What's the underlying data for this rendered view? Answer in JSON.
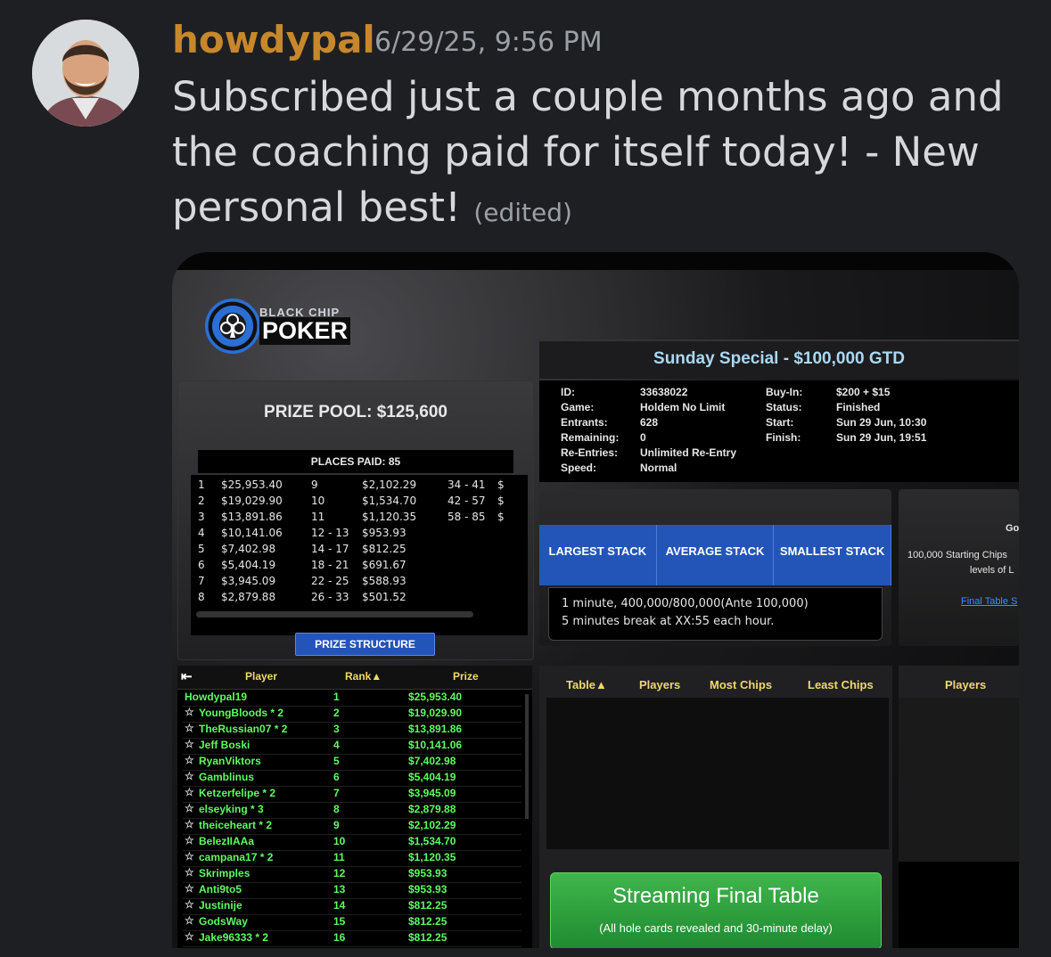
{
  "post": {
    "username": "howdypal",
    "timestamp": "6/29/25, 9:56 PM",
    "text": "Subscribed just a couple months ago and the coaching paid for itself today! - New personal best!",
    "edited": "(edited)"
  },
  "poker": {
    "logo_top": "BLACK CHIP",
    "logo_bottom": "POKER",
    "tournament_title": "Sunday Special - $100,000 GTD",
    "prize_pool": "PRIZE POOL: $125,600",
    "places_paid": "PLACES PAID: 85",
    "prize_button": "PRIZE STRUCTURE",
    "prize_rows": [
      [
        "1",
        "$25,953.40",
        "9",
        "$2,102.29",
        "34 - 41",
        "$"
      ],
      [
        "2",
        "$19,029.90",
        "10",
        "$1,534.70",
        "42 - 57",
        "$"
      ],
      [
        "3",
        "$13,891.86",
        "11",
        "$1,120.35",
        "58 - 85",
        "$"
      ],
      [
        "4",
        "$10,141.06",
        "12 - 13",
        "$953.93",
        "",
        ""
      ],
      [
        "5",
        "$7,402.98",
        "14 - 17",
        "$812.25",
        "",
        ""
      ],
      [
        "6",
        "$5,404.19",
        "18 - 21",
        "$691.67",
        "",
        ""
      ],
      [
        "7",
        "$3,945.09",
        "22 - 25",
        "$588.93",
        "",
        ""
      ],
      [
        "8",
        "$2,879.88",
        "26 - 33",
        "$501.52",
        "",
        ""
      ]
    ],
    "info_left": [
      [
        "ID:",
        "33638022"
      ],
      [
        "Game:",
        "Holdem No Limit"
      ],
      [
        "Entrants:",
        "628"
      ],
      [
        "Remaining:",
        "0"
      ],
      [
        "Re-Entries:",
        "Unlimited Re-Entry"
      ],
      [
        "Speed:",
        "Normal"
      ]
    ],
    "info_right": [
      [
        "Buy-In:",
        "$200 + $15"
      ],
      [
        "Status:",
        "Finished"
      ],
      [
        "Start:",
        "Sun 29 Jun, 10:30"
      ],
      [
        "Finish:",
        "Sun 29 Jun, 19:51"
      ]
    ],
    "stack_headers": [
      "LARGEST STACK",
      "AVERAGE STACK",
      "SMALLEST STACK"
    ],
    "blinds_line1": "1 minute, 400,000/800,000(Ante 100,000)",
    "blinds_line2": "5 minutes break at XX:55 each hour.",
    "right_panel": {
      "top_fragment": "Go",
      "line1": "100,000 Starting Chips",
      "line2": "levels of L",
      "link": "Final Table S"
    },
    "players_headers": {
      "back": "⇤",
      "player": "Player",
      "rank": "Rank▲",
      "prize": "Prize"
    },
    "players": [
      {
        "name": "Howdypal19",
        "star": false,
        "rank": "1",
        "prize": "$25,953.40"
      },
      {
        "name": "YoungBloods * 2",
        "star": true,
        "rank": "2",
        "prize": "$19,029.90"
      },
      {
        "name": "TheRussian07 * 2",
        "star": true,
        "rank": "3",
        "prize": "$13,891.86"
      },
      {
        "name": "Jeff Boski",
        "star": true,
        "rank": "4",
        "prize": "$10,141.06"
      },
      {
        "name": "RyanViktors",
        "star": true,
        "rank": "5",
        "prize": "$7,402.98"
      },
      {
        "name": "Gamblinus",
        "star": true,
        "rank": "6",
        "prize": "$5,404.19"
      },
      {
        "name": "Ketzerfelipe * 2",
        "star": true,
        "rank": "7",
        "prize": "$3,945.09"
      },
      {
        "name": "elseyking * 3",
        "star": true,
        "rank": "8",
        "prize": "$2,879.88"
      },
      {
        "name": "theiceheart * 2",
        "star": true,
        "rank": "9",
        "prize": "$2,102.29"
      },
      {
        "name": "BelezIIAAa",
        "star": true,
        "rank": "10",
        "prize": "$1,534.70"
      },
      {
        "name": "campana17 * 2",
        "star": true,
        "rank": "11",
        "prize": "$1,120.35"
      },
      {
        "name": "Skrimples",
        "star": true,
        "rank": "12",
        "prize": "$953.93"
      },
      {
        "name": "Anti9to5",
        "star": true,
        "rank": "13",
        "prize": "$953.93"
      },
      {
        "name": "Justinije",
        "star": true,
        "rank": "14",
        "prize": "$812.25"
      },
      {
        "name": "GodsWay",
        "star": true,
        "rank": "15",
        "prize": "$812.25"
      },
      {
        "name": "Jake96333 * 2",
        "star": true,
        "rank": "16",
        "prize": "$812.25"
      }
    ],
    "tables_headers": [
      "Table▲",
      "Players",
      "Most Chips",
      "Least Chips"
    ],
    "players2_header": "Players",
    "stream_title": "Streaming Final Table",
    "stream_sub": "(All hole cards revealed and 30-minute delay)"
  },
  "colors": {
    "username": "#c7872b",
    "player_green": "#5dfb62",
    "header_gold": "#f0d86a",
    "accent_blue": "#2355b8",
    "stream_green": "#2f9e3e"
  }
}
